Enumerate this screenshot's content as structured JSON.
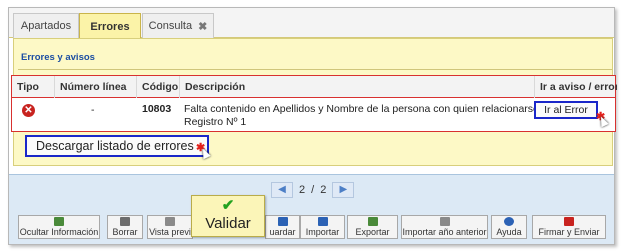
{
  "tabs": [
    {
      "label": "Apartados",
      "active": false
    },
    {
      "label": "Errores",
      "active": true
    },
    {
      "label": "Consulta",
      "active": false,
      "close_icon": "close-x-icon"
    }
  ],
  "panel": {
    "title": "Errores y avisos"
  },
  "table": {
    "headers": [
      "Tipo",
      "Número línea",
      "Código",
      "Descripción",
      "Ir a aviso / error"
    ],
    "rows": [
      {
        "tipo_icon": "error-circle-icon",
        "numero_linea": "-",
        "codigo": "10803",
        "descripcion_line1": "Falta contenido en Apellidos y Nombre de la persona con quien relacionarse",
        "descripcion_line2": "Registro Nº 1",
        "ir_button": "Ir al Error"
      }
    ]
  },
  "descargar_button": "Descargar listado de errores",
  "pager": {
    "current": "2",
    "separator": "/",
    "total": "2",
    "prev_icon": "prev-arrow-icon",
    "next_icon": "next-arrow-icon"
  },
  "validar": {
    "label": "Validar",
    "icon": "checkmark-icon",
    "icon_color": "#23a21f"
  },
  "toolbar": [
    {
      "label": "Ocultar Información",
      "icon": "hide-info-icon",
      "color": "#4a8a3a"
    },
    {
      "label": "Borrar",
      "icon": "trash-icon",
      "color": "#6d6d6d"
    },
    {
      "label": "Vista previ",
      "icon": "preview-icon",
      "color": "#8a8a8a"
    },
    {
      "label": "uardar",
      "icon": "save-icon",
      "color": "#2c62b5"
    },
    {
      "label": "Importar",
      "icon": "import-icon",
      "color": "#2c62b5"
    },
    {
      "label": "Exportar",
      "icon": "export-icon",
      "color": "#4a8a3a"
    },
    {
      "label": "Importar año anterior",
      "icon": "import-previous-icon",
      "color": "#8a8a8a"
    },
    {
      "label": "Ayuda",
      "icon": "help-icon",
      "color": "#2c62b5"
    },
    {
      "label": "Firmar y Enviar",
      "icon": "sign-send-icon",
      "color": "#c8231f"
    }
  ],
  "colors": {
    "panel_bg": "#fdf9c6",
    "error_red": "#c8231f",
    "highlight_blue": "#1a27c9",
    "bottom_bg": "#dce9f5"
  }
}
